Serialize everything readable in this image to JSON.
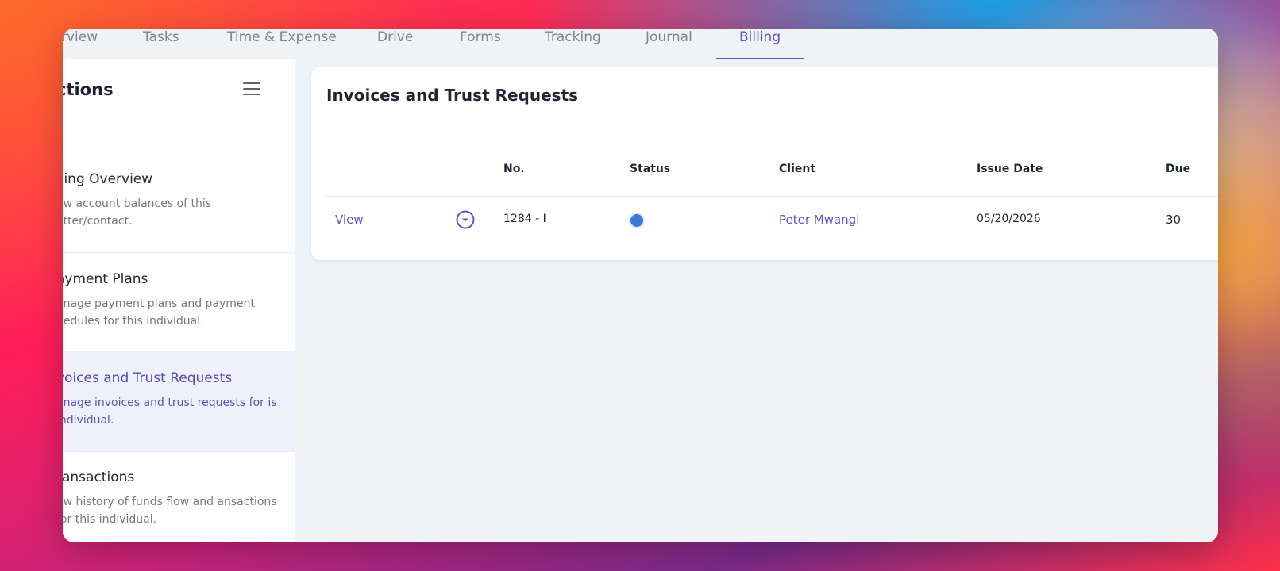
{
  "tabs": [
    "rview",
    "Tasks",
    "Time & Expense",
    "Drive",
    "Forms",
    "Tracking",
    "Journal",
    "Billing"
  ],
  "active_tab": "Billing",
  "sidebar": {
    "title": "ctions",
    "sections": [
      {
        "title": "lling Overview",
        "desc": "ew account balances of this atter/contact."
      },
      {
        "title": "ayment Plans",
        "desc": "anage payment plans and payment hedules for this individual."
      },
      {
        "title": "voices and Trust Requests",
        "desc": "anage invoices and trust requests for is individual."
      },
      {
        "title": "ransactions",
        "desc": "ew history of funds flow and ansactions for this individual."
      }
    ]
  },
  "main": {
    "title": "Invoices and Trust Requests",
    "columns": [
      "No.",
      "Status",
      "Client",
      "Issue Date",
      "Due"
    ],
    "rows": [
      {
        "action": "View",
        "no": "1284 - I",
        "status_color": "#3b78d9",
        "client": "Peter Mwangi",
        "issue_date": "05/20/2026",
        "due": "30"
      }
    ]
  },
  "colors": {
    "accent": "#5b55c9",
    "status_blue": "#3b78d9"
  }
}
